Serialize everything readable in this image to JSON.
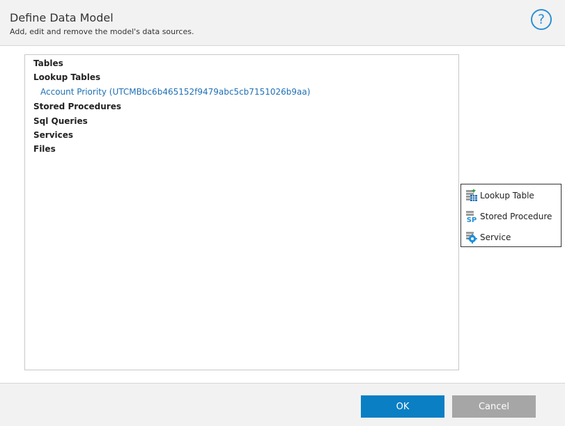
{
  "dialog": {
    "title": "Define Data Model",
    "subtitle": "Add, edit and remove the model's data sources.",
    "help_icon": "question-circle-icon"
  },
  "tree": {
    "categories": [
      {
        "label": "Tables",
        "children": []
      },
      {
        "label": "Lookup Tables",
        "children": [
          "Account Priority (UTCMBbc6b465152f9479abc5cb7151026b9aa)"
        ]
      },
      {
        "label": "Stored Procedures",
        "children": []
      },
      {
        "label": "Sql Queries",
        "children": []
      },
      {
        "label": "Services",
        "children": []
      },
      {
        "label": "Files",
        "children": []
      }
    ]
  },
  "context_menu": {
    "items": [
      {
        "label": "Lookup Table",
        "icon": "lookup-table-icon"
      },
      {
        "label": "Stored Procedure",
        "icon": "stored-procedure-icon"
      },
      {
        "label": "Service",
        "icon": "service-gear-icon"
      }
    ]
  },
  "footer": {
    "ok_label": "OK",
    "cancel_label": "Cancel"
  },
  "colors": {
    "accent": "#0a7fc4",
    "link": "#1f6fb5",
    "cancel": "#a6a6a6",
    "header_bg": "#f2f2f2"
  }
}
